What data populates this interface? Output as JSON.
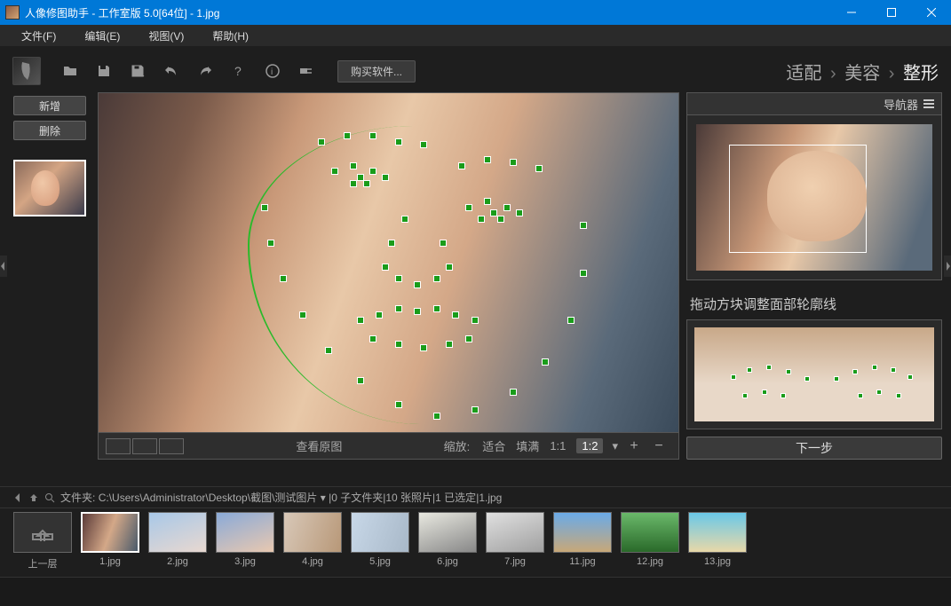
{
  "titlebar": {
    "title": "人像修图助手 - 工作室版 5.0[64位] - 1.jpg"
  },
  "menubar": {
    "file": "文件(F)",
    "edit": "编辑(E)",
    "view": "视图(V)",
    "help": "帮助(H)"
  },
  "toolbar": {
    "buy": "购买软件..."
  },
  "breadcrumb": {
    "a": "适配",
    "b": "美容",
    "c": "整形"
  },
  "left": {
    "new": "新增",
    "delete": "删除"
  },
  "canvas": {
    "view_original": "查看原图",
    "zoom_label": "缩放:",
    "fit": "适合",
    "fill": "填满",
    "r11": "1:1",
    "r12": "1:2"
  },
  "right": {
    "navigator": "导航器",
    "hint": "拖动方块调整面部轮廓线",
    "next": "下一步"
  },
  "path": {
    "label": "文件夹:",
    "path": "C:\\Users\\Administrator\\Desktop\\截图\\测试图片",
    "subfolders": "0 子文件夹",
    "photos": "10 张照片",
    "selected": "1 已选定",
    "current": "1.jpg"
  },
  "filmstrip": {
    "up": "上一层",
    "items": [
      "1.jpg",
      "2.jpg",
      "3.jpg",
      "4.jpg",
      "5.jpg",
      "6.jpg",
      "7.jpg",
      "11.jpg",
      "12.jpg",
      "13.jpg"
    ]
  }
}
